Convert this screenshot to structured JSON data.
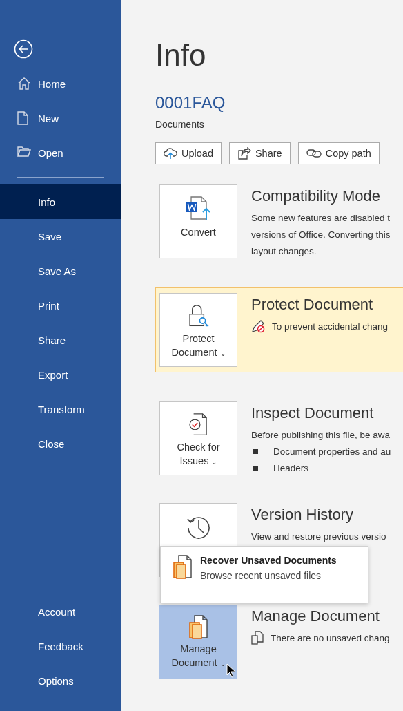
{
  "sidebar": {
    "top_items": [
      {
        "label": "Home",
        "kind": "home"
      },
      {
        "label": "New",
        "kind": "new"
      },
      {
        "label": "Open",
        "kind": "open"
      }
    ],
    "items": [
      {
        "label": "Info",
        "selected": true
      },
      {
        "label": "Save",
        "selected": false
      },
      {
        "label": "Save As",
        "selected": false
      },
      {
        "label": "Print",
        "selected": false
      },
      {
        "label": "Share",
        "selected": false
      },
      {
        "label": "Export",
        "selected": false
      },
      {
        "label": "Transform",
        "selected": false
      },
      {
        "label": "Close",
        "selected": false
      }
    ],
    "bottom_items": [
      {
        "label": "Account"
      },
      {
        "label": "Feedback"
      },
      {
        "label": "Options"
      }
    ]
  },
  "page_title": "Info",
  "document": {
    "name": "0001FAQ",
    "location": "Documents"
  },
  "toolbar": [
    {
      "label": "Upload",
      "kind": "upload"
    },
    {
      "label": "Share",
      "kind": "share"
    },
    {
      "label": "Copy path",
      "kind": "link"
    }
  ],
  "sections": [
    {
      "kind": "convert",
      "button": "Convert",
      "pressed": false,
      "highlighted": false,
      "title": "Compatibility Mode",
      "lines": [
        {
          "kind": "text",
          "text": "Some new features are disabled t"
        },
        {
          "kind": "text",
          "text": "versions of Office. Converting this"
        },
        {
          "kind": "text",
          "text": "layout changes."
        }
      ]
    },
    {
      "kind": "protect",
      "button": "Protect Document",
      "caret": "⌄",
      "pressed": false,
      "highlighted": true,
      "title": "Protect Document",
      "lines": [
        {
          "kind": "note",
          "text": "To prevent accidental chang"
        }
      ]
    },
    {
      "kind": "inspect",
      "button": "Check for Issues",
      "caret": "⌄",
      "pressed": false,
      "highlighted": false,
      "title": "Inspect Document",
      "lines": [
        {
          "kind": "text",
          "text": "Before publishing this file, be awa"
        },
        {
          "kind": "bullet",
          "text": "Document properties and au"
        },
        {
          "kind": "bullet",
          "text": "Headers"
        }
      ]
    },
    {
      "kind": "version",
      "pressed": false,
      "highlighted": false,
      "title": "Version History",
      "lines": [
        {
          "kind": "text",
          "text": "View and restore previous versio"
        }
      ]
    },
    {
      "kind": "manage",
      "button": "Manage Document",
      "caret": "⌄",
      "pressed": true,
      "highlighted": false,
      "title": "Manage Document",
      "lines": [
        {
          "kind": "doc",
          "text": "There are no unsaved chang"
        }
      ]
    }
  ],
  "popup": {
    "title": "Recover Unsaved Documents",
    "subtitle": "Browse recent unsaved files"
  }
}
